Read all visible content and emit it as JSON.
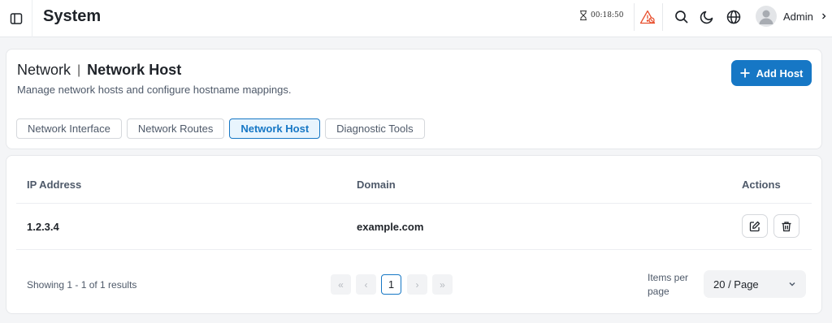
{
  "app": {
    "title": "System"
  },
  "topbar": {
    "timer": "00:18:50",
    "user_name": "Admin",
    "icons": [
      "sidebar-toggle-icon",
      "hourglass-icon",
      "warning-icon",
      "search-icon",
      "moon-icon",
      "globe-icon",
      "user-avatar-icon",
      "chevron-right-icon"
    ],
    "warning_color": "#e8502f"
  },
  "header": {
    "breadcrumb_parent": "Network",
    "breadcrumb_separator": "|",
    "title": "Network Host",
    "description": "Manage network hosts and configure hostname mappings.",
    "add_button": "Add Host",
    "accent_color": "#1677c5"
  },
  "tabs": [
    {
      "label": "Network Interface",
      "active": false
    },
    {
      "label": "Network Routes",
      "active": false
    },
    {
      "label": "Network Host",
      "active": true
    },
    {
      "label": "Diagnostic Tools",
      "active": false
    }
  ],
  "table": {
    "columns": {
      "ip": "IP Address",
      "domain": "Domain",
      "actions": "Actions"
    },
    "rows": [
      {
        "ip": "1.2.3.4",
        "domain": "example.com"
      }
    ]
  },
  "pagination": {
    "summary": "Showing 1 - 1 of 1 results",
    "current_page": "1",
    "items_per_page_label": "Items per page",
    "page_size": "20 / Page"
  }
}
